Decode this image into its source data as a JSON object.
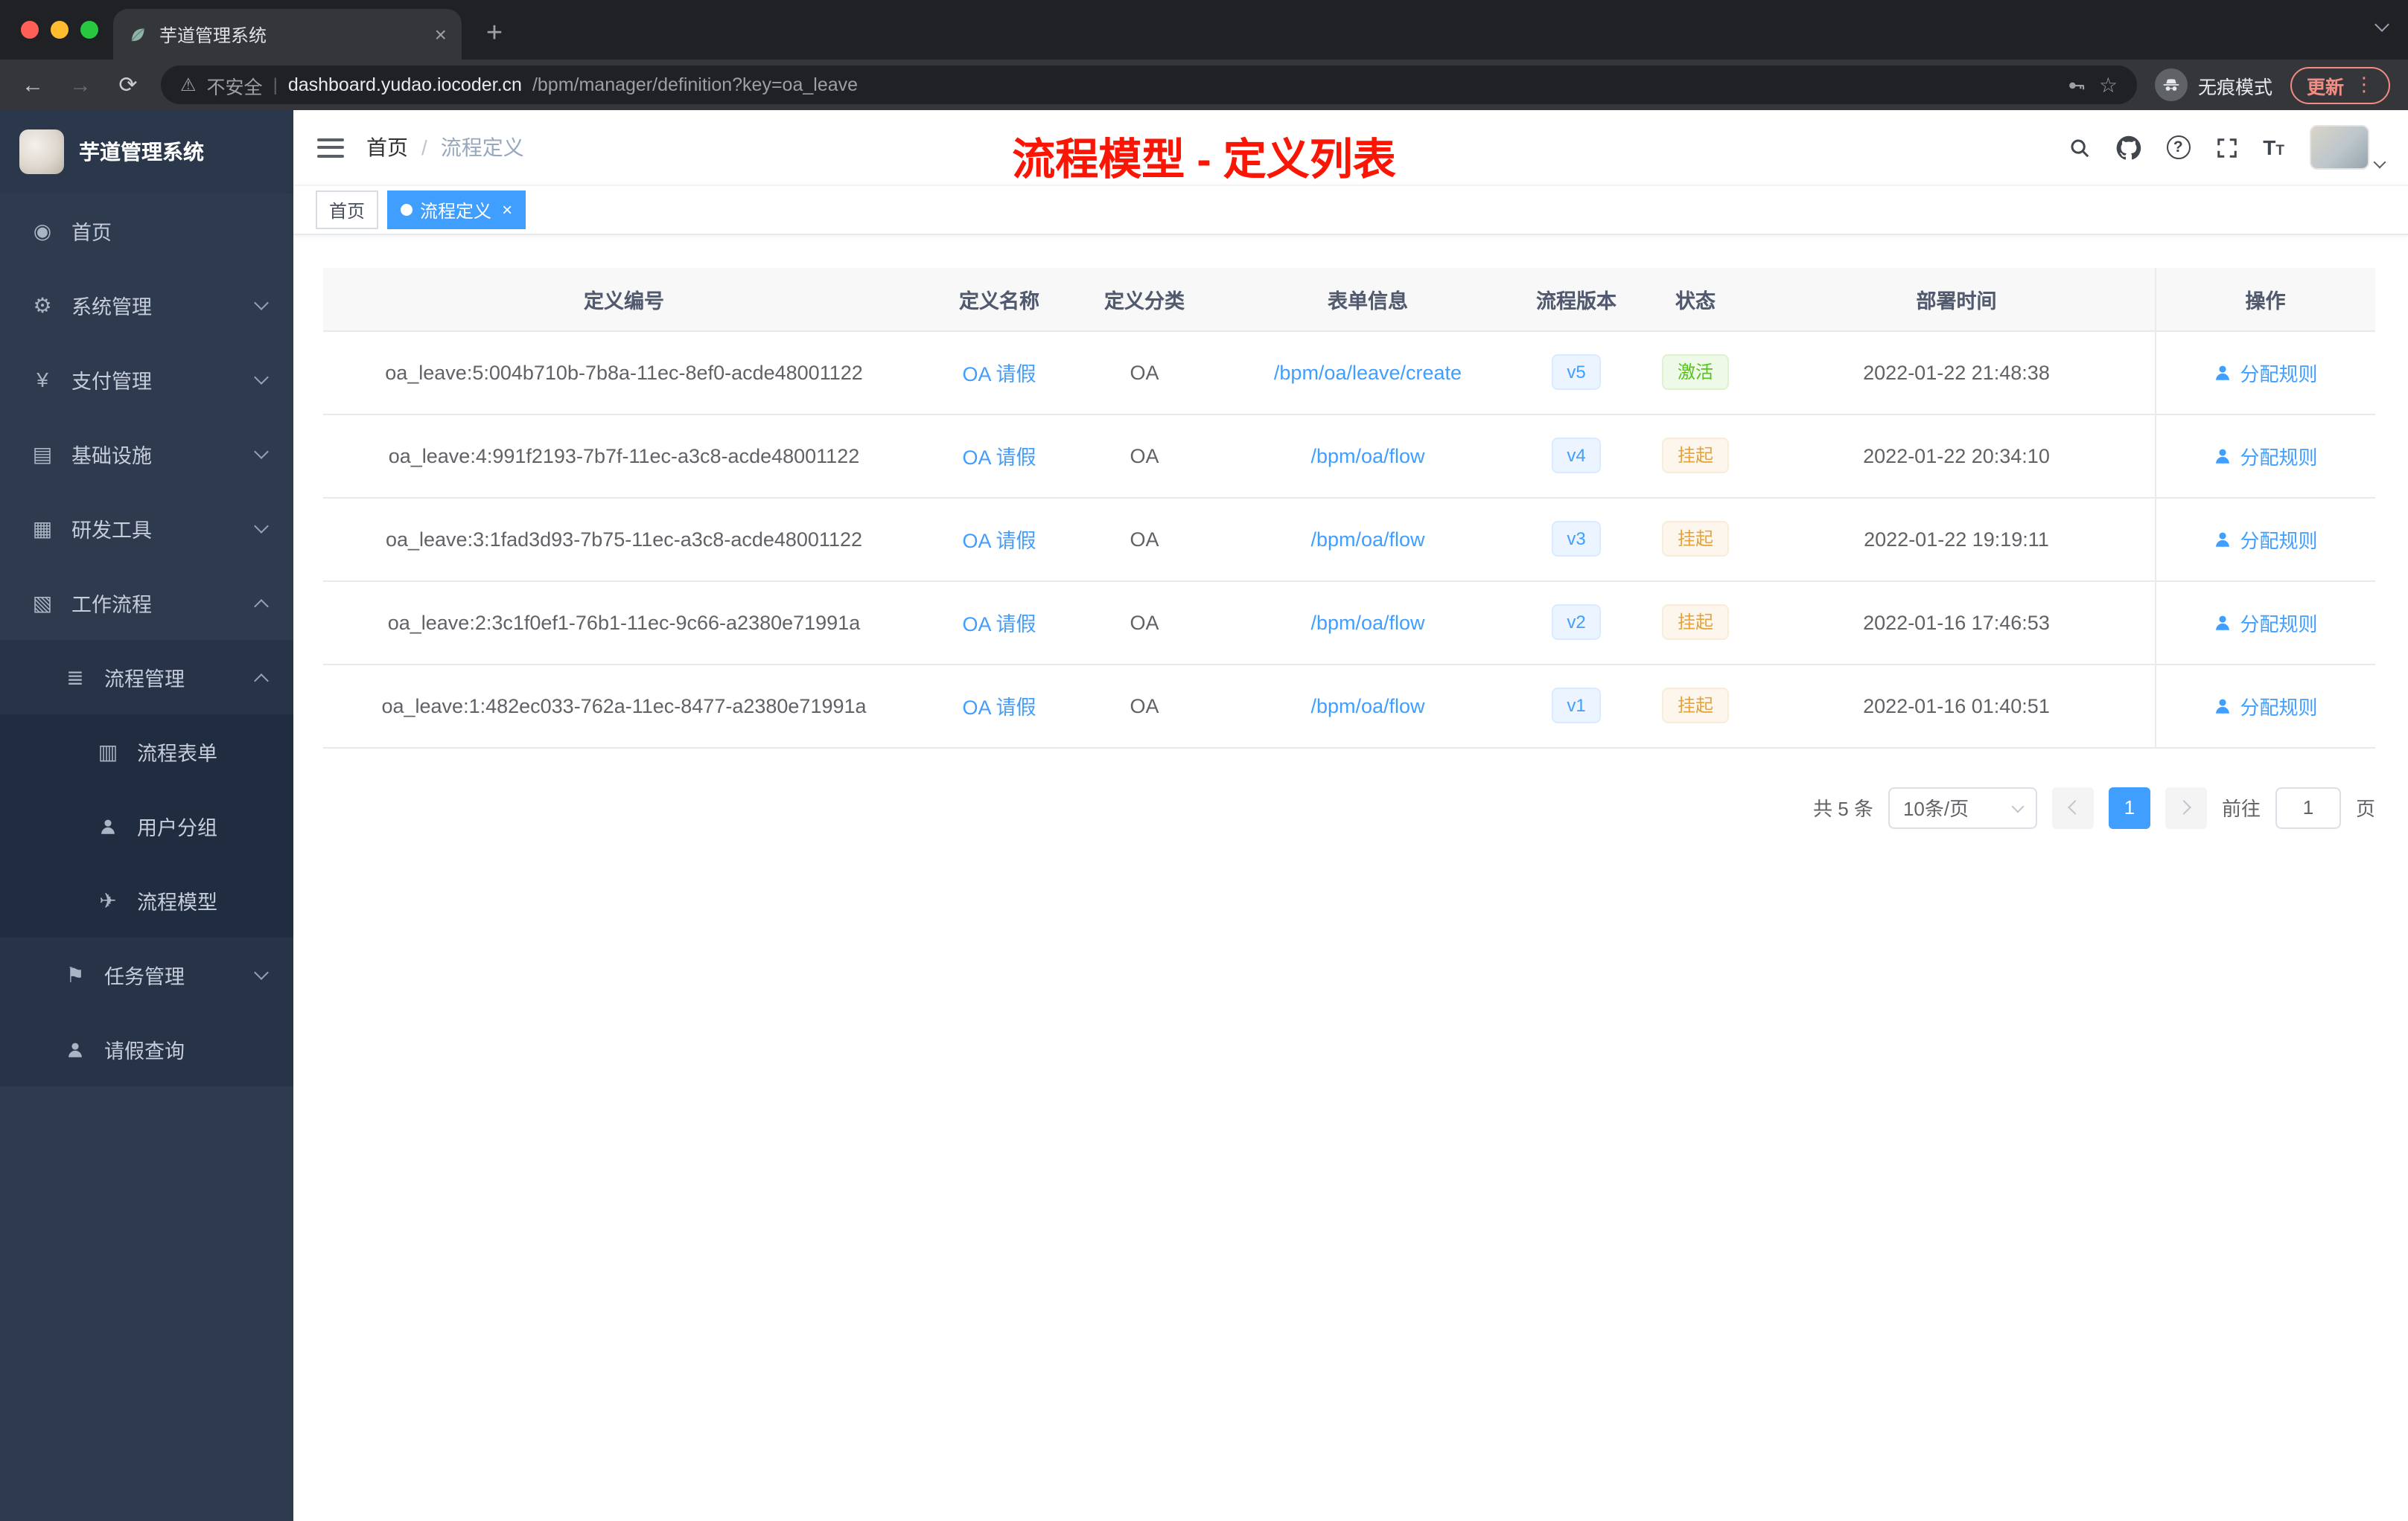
{
  "colors": {
    "primary": "#409eff",
    "success_text": "#52c41a",
    "warning_text": "#e6a23c",
    "annotation_red": "#fb1505",
    "sidebar_bg": "#2e3a4e",
    "chrome_bg": "#202124"
  },
  "icons": {
    "back": "←",
    "forward": "→",
    "reload": "⟳",
    "warning": "⚠",
    "divider": "|",
    "star": "☆",
    "plus": "+",
    "close": "×",
    "dots": "⋮",
    "help": "?",
    "font_large": "T",
    "font_small": "T"
  },
  "browser": {
    "tab_title": "芋道管理系统",
    "security_label": "不安全",
    "url_host": "dashboard.yudao.iocoder.cn",
    "url_path": "/bpm/manager/definition?key=oa_leave",
    "incognito_label": "无痕模式",
    "update_label": "更新"
  },
  "sidebar": {
    "logo_title": "芋道管理系统",
    "icon_glyphs": {
      "home": "◉",
      "gear": "⚙",
      "yen": "¥",
      "infra": "▤",
      "tools": "▦",
      "workflow": "▧",
      "list": "≣",
      "form": "▥",
      "model": "✈",
      "tasks": "⚑"
    },
    "items": [
      {
        "id": "home",
        "label": "首页",
        "level": 1,
        "icon": "home"
      },
      {
        "id": "system",
        "label": "系统管理",
        "level": 1,
        "icon": "gear",
        "arrow": "down"
      },
      {
        "id": "payment",
        "label": "支付管理",
        "level": 1,
        "icon": "yen",
        "arrow": "down"
      },
      {
        "id": "infra",
        "label": "基础设施",
        "level": 1,
        "icon": "infra",
        "arrow": "down"
      },
      {
        "id": "devtools",
        "label": "研发工具",
        "level": 1,
        "icon": "tools",
        "arrow": "down"
      },
      {
        "id": "workflow",
        "label": "工作流程",
        "level": 1,
        "icon": "workflow",
        "arrow": "up"
      },
      {
        "id": "process-mgmt",
        "label": "流程管理",
        "level": 2,
        "icon": "list",
        "arrow": "up"
      },
      {
        "id": "process-form",
        "label": "流程表单",
        "level": 3,
        "icon": "form"
      },
      {
        "id": "user-group",
        "label": "用户分组",
        "level": 3,
        "icon": "users"
      },
      {
        "id": "process-model",
        "label": "流程模型",
        "level": 3,
        "icon": "model"
      },
      {
        "id": "task-mgmt",
        "label": "任务管理",
        "level": 2,
        "icon": "tasks",
        "arrow": "down"
      },
      {
        "id": "leave-query",
        "label": "请假查询",
        "level": 2,
        "icon": "user"
      }
    ]
  },
  "header": {
    "breadcrumb": {
      "home": "首页",
      "separator": "/",
      "current": "流程定义"
    },
    "annotation": "流程模型 - 定义列表"
  },
  "tags": [
    {
      "label": "首页",
      "active": false
    },
    {
      "label": "流程定义",
      "active": true
    }
  ],
  "table": {
    "columns": [
      "定义编号",
      "定义名称",
      "定义分类",
      "表单信息",
      "流程版本",
      "状态",
      "部署时间",
      "操作"
    ],
    "rows": [
      {
        "id": "oa_leave:5:004b710b-7b8a-11ec-8ef0-acde48001122",
        "name": "OA 请假",
        "category": "OA",
        "form": "/bpm/oa/leave/create",
        "version": "v5",
        "status": "激活",
        "status_type": "success",
        "deploy_time": "2022-01-22 21:48:38",
        "action": "分配规则"
      },
      {
        "id": "oa_leave:4:991f2193-7b7f-11ec-a3c8-acde48001122",
        "name": "OA 请假",
        "category": "OA",
        "form": "/bpm/oa/flow",
        "version": "v4",
        "status": "挂起",
        "status_type": "warning",
        "deploy_time": "2022-01-22 20:34:10",
        "action": "分配规则"
      },
      {
        "id": "oa_leave:3:1fad3d93-7b75-11ec-a3c8-acde48001122",
        "name": "OA 请假",
        "category": "OA",
        "form": "/bpm/oa/flow",
        "version": "v3",
        "status": "挂起",
        "status_type": "warning",
        "deploy_time": "2022-01-22 19:19:11",
        "action": "分配规则"
      },
      {
        "id": "oa_leave:2:3c1f0ef1-76b1-11ec-9c66-a2380e71991a",
        "name": "OA 请假",
        "category": "OA",
        "form": "/bpm/oa/flow",
        "version": "v2",
        "status": "挂起",
        "status_type": "warning",
        "deploy_time": "2022-01-16 17:46:53",
        "action": "分配规则"
      },
      {
        "id": "oa_leave:1:482ec033-762a-11ec-8477-a2380e71991a",
        "name": "OA 请假",
        "category": "OA",
        "form": "/bpm/oa/flow",
        "version": "v1",
        "status": "挂起",
        "status_type": "warning",
        "deploy_time": "2022-01-16 01:40:51",
        "action": "分配规则"
      }
    ]
  },
  "pagination": {
    "total_label": "共 5 条",
    "page_size": "10条/页",
    "current_page": "1",
    "goto_label": "前往",
    "goto_value": "1",
    "page_unit": "页"
  }
}
